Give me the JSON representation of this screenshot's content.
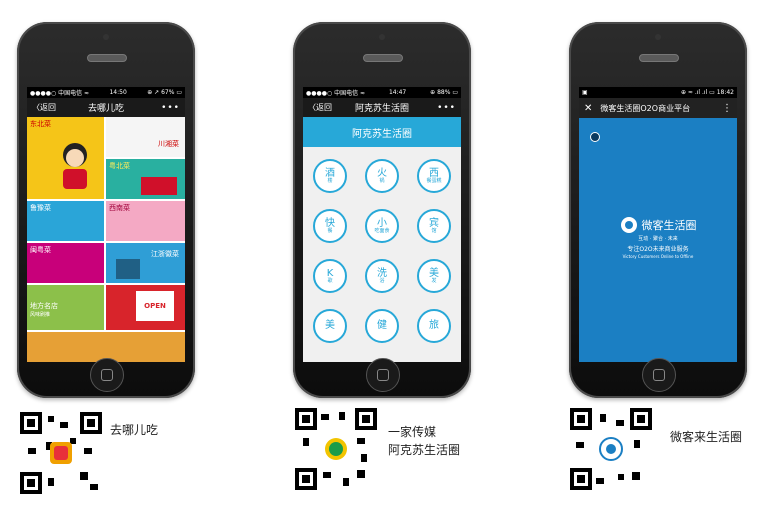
{
  "phones": [
    {
      "status": {
        "carrier": "●●●●○ 中国电信 ≈",
        "time": "14:50",
        "battery": "⊕ ↗ 67% ▭"
      },
      "nav": {
        "back": "〈返回",
        "title": "去哪儿吃",
        "more": "•••"
      },
      "tiles": [
        "东北菜",
        "川湘菜",
        "粤北菜",
        "鲁豫菜",
        "西南菜",
        "闽粤菜",
        "江浙徽菜",
        "地方名店",
        "风味刷推",
        "OPEN"
      ]
    },
    {
      "status": {
        "carrier": "●●●●○ 中国电信 ≈",
        "time": "14:47",
        "battery": "⊕ 88% ▭"
      },
      "nav": {
        "back": "〈返回",
        "title": "阿克苏生活圈",
        "more": "•••"
      },
      "banner": "阿克苏生活圈",
      "circles": [
        {
          "main": "酒",
          "sub": "楼"
        },
        {
          "main": "火",
          "sub": "锅"
        },
        {
          "main": "西",
          "sub": "餐蛋糕"
        },
        {
          "main": "快",
          "sub": "餐"
        },
        {
          "main": "小",
          "sub": "吃面食"
        },
        {
          "main": "宾",
          "sub": "馆"
        },
        {
          "main": "K",
          "sub": "歌"
        },
        {
          "main": "洗",
          "sub": "浴"
        },
        {
          "main": "美",
          "sub": "发"
        },
        {
          "main": "美",
          "sub": ""
        },
        {
          "main": "健",
          "sub": ""
        },
        {
          "main": "旅",
          "sub": ""
        }
      ]
    },
    {
      "status": {
        "left": "▣",
        "right": "⊕ ≈ .ıl .ıl ▭ 18:42"
      },
      "nav": {
        "close": "✕",
        "title": "微客生活圈O2O商业平台",
        "more": "⋮"
      },
      "logo": {
        "name": "微客生活圈",
        "tag": "互动 · 聚合 · 未来",
        "line1": "专注O2O未来商业服务",
        "line2": "Victory Customers Online to Offline"
      }
    }
  ],
  "captions": [
    "去哪儿吃",
    "一家传媒",
    "阿克苏生活圈",
    "微客来生活圈"
  ]
}
